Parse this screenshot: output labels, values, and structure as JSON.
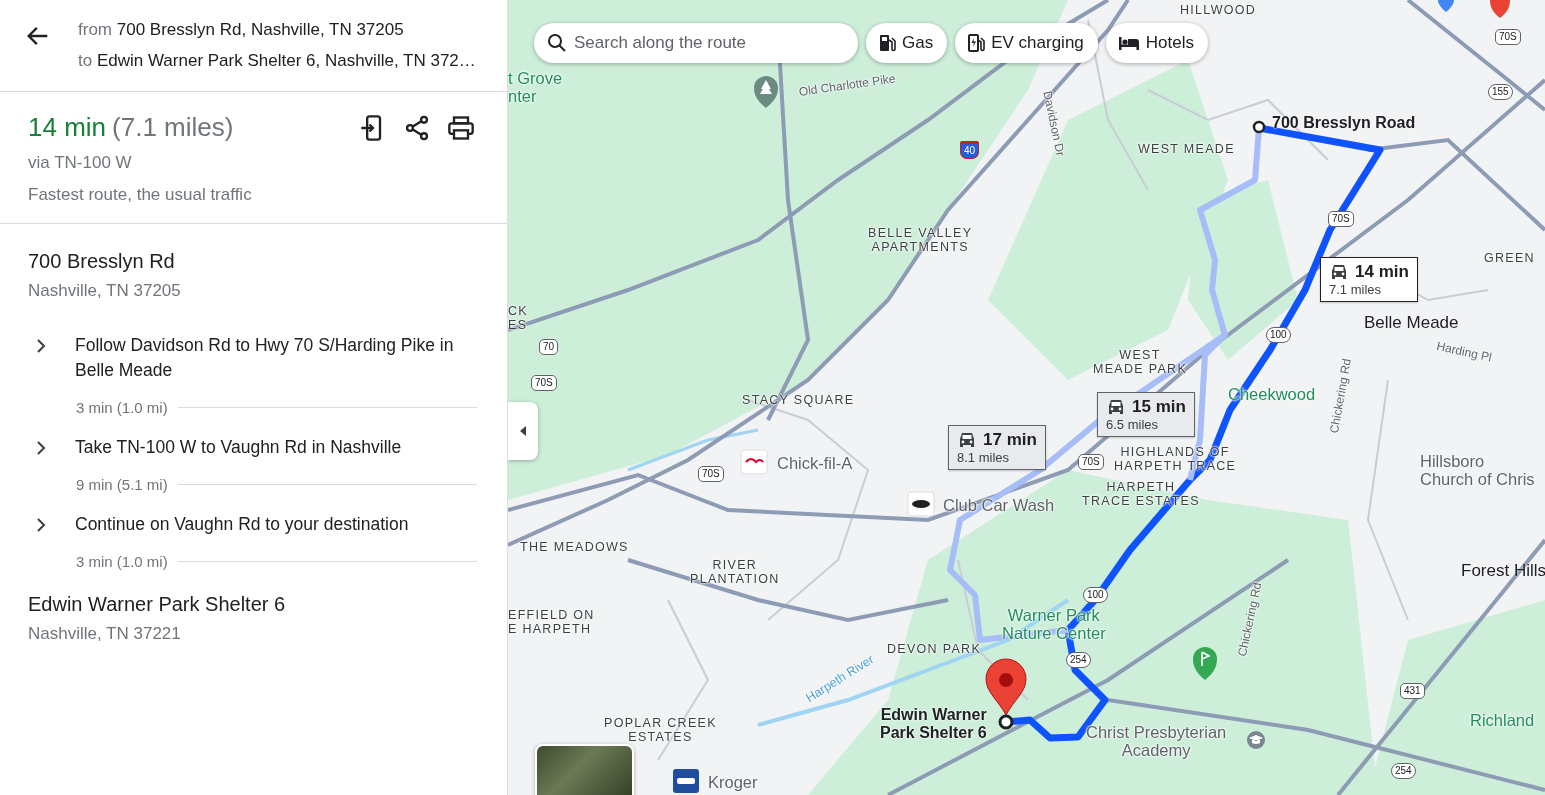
{
  "header": {
    "from_prefix": "from",
    "from": "700 Bresslyn Rd, Nashville, TN 37205",
    "to_prefix": "to",
    "to": "Edwin Warner Park Shelter 6, Nashville, TN 372…"
  },
  "summary": {
    "duration": "14 min",
    "distance": "(7.1 miles)",
    "via": "via TN-100 W",
    "note": "Fastest route, the usual traffic"
  },
  "origin": {
    "name": "700 Bresslyn Rd",
    "address": "Nashville, TN 37205"
  },
  "steps": [
    {
      "text": "Follow Davidson Rd to Hwy 70 S/Harding Pike in Belle Meade",
      "meta": "3 min (1.0 mi)",
      "expanded": false
    },
    {
      "text": "Take TN-100 W to Vaughn Rd in Nashville",
      "meta": "9 min (5.1 mi)",
      "expanded": false
    },
    {
      "text": "Continue on Vaughn Rd to your destination",
      "meta": "3 min (1.0 mi)",
      "expanded": false
    }
  ],
  "destination": {
    "name": "Edwin Warner Park Shelter 6",
    "address": "Nashville, TN 37221"
  },
  "map": {
    "search": {
      "placeholder": "Search along the route"
    },
    "chips": [
      {
        "kind": "gas",
        "label": "Gas"
      },
      {
        "kind": "ev",
        "label": "EV charging"
      },
      {
        "kind": "hotel",
        "label": "Hotels"
      }
    ],
    "routes": [
      {
        "time": "14 min",
        "distance": "7.1 miles",
        "selected": true
      },
      {
        "time": "15 min",
        "distance": "6.5 miles",
        "selected": false
      },
      {
        "time": "17 min",
        "distance": "8.1 miles",
        "selected": false
      }
    ],
    "labels": [
      {
        "text": "HILLWOOD",
        "kind": "area"
      },
      {
        "text": "t Grove\nnter",
        "kind": "poi-green"
      },
      {
        "text": "WEST MEADE",
        "kind": "area"
      },
      {
        "text": "BELLE VALLEY\nAPARTMENTS",
        "kind": "area"
      },
      {
        "text": "700 Bresslyn Road",
        "kind": "place-bold"
      },
      {
        "text": "GREEN",
        "kind": "area"
      },
      {
        "text": "Belle Meade",
        "kind": "place"
      },
      {
        "text": "CK\nES",
        "kind": "area"
      },
      {
        "text": "WEST\nMEADE PARK",
        "kind": "area"
      },
      {
        "text": "STACY SQUARE",
        "kind": "area"
      },
      {
        "text": "Cheekwood",
        "kind": "poi-green"
      },
      {
        "text": "HIGHLANDS OF\nHARPETH TRACE",
        "kind": "area"
      },
      {
        "text": "HARPETH\nTRACE ESTATES",
        "kind": "area"
      },
      {
        "text": "Chick-fil-A",
        "kind": "poi"
      },
      {
        "text": "Hillsboro\nChurch of Chris",
        "kind": "poi"
      },
      {
        "text": "Club Car Wash",
        "kind": "poi"
      },
      {
        "text": "THE MEADOWS",
        "kind": "area"
      },
      {
        "text": "RIVER\nPLANTATION",
        "kind": "area"
      },
      {
        "text": "Forest Hills",
        "kind": "place"
      },
      {
        "text": "EFFIELD ON\nE HARPETH",
        "kind": "area"
      },
      {
        "text": "Warner Park\nNature Center",
        "kind": "poi-green"
      },
      {
        "text": "DEVON PARK",
        "kind": "area"
      },
      {
        "text": "POPLAR CREEK\nESTATES",
        "kind": "area"
      },
      {
        "text": "Edwin Warner\nPark Shelter 6",
        "kind": "place-bold"
      },
      {
        "text": "Christ Presbyterian\nAcademy",
        "kind": "poi"
      },
      {
        "text": "Richland",
        "kind": "poi-green"
      },
      {
        "text": "Kroger",
        "kind": "poi"
      },
      {
        "text": "Old Charlotte Pike",
        "kind": "road"
      },
      {
        "text": "Davidson Dr",
        "kind": "road"
      },
      {
        "text": "Harding Pl",
        "kind": "road"
      },
      {
        "text": "Chickering Rd",
        "kind": "road"
      },
      {
        "text": "Chickering Rd",
        "kind": "road"
      },
      {
        "text": "Harpeth River",
        "kind": "water"
      }
    ],
    "shields": [
      {
        "text": "70S",
        "kind": "us"
      },
      {
        "text": "155",
        "kind": "state"
      },
      {
        "text": "40",
        "kind": "interstate"
      },
      {
        "text": "70S",
        "kind": "us"
      },
      {
        "text": "100",
        "kind": "state"
      },
      {
        "text": "70",
        "kind": "us"
      },
      {
        "text": "70S",
        "kind": "us"
      },
      {
        "text": "70S",
        "kind": "us"
      },
      {
        "text": "70S",
        "kind": "us"
      },
      {
        "text": "100",
        "kind": "state"
      },
      {
        "text": "254",
        "kind": "state"
      },
      {
        "text": "431",
        "kind": "us"
      },
      {
        "text": "254",
        "kind": "state"
      }
    ]
  }
}
